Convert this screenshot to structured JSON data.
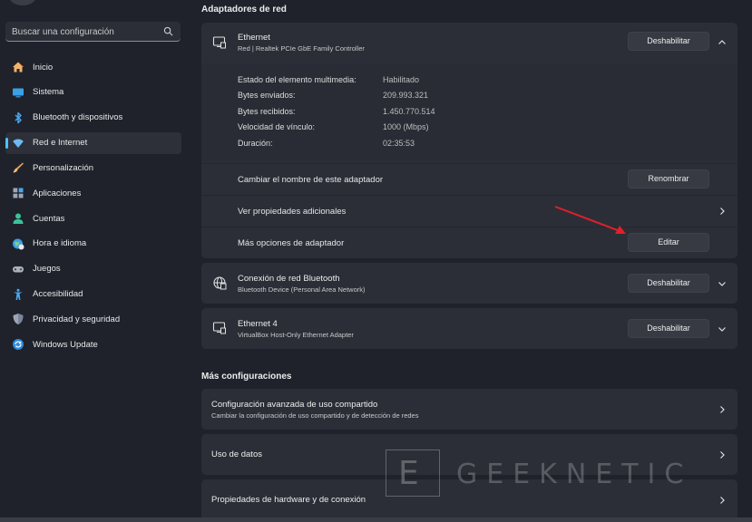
{
  "search": {
    "placeholder": "Buscar una configuración"
  },
  "sidebar": {
    "items": [
      {
        "label": "Inicio",
        "icon": "home-icon",
        "active": false
      },
      {
        "label": "Sistema",
        "icon": "monitor-icon",
        "active": false
      },
      {
        "label": "Bluetooth y dispositivos",
        "icon": "bluetooth-icon",
        "active": false
      },
      {
        "label": "Red e Internet",
        "icon": "wifi-network-icon",
        "active": true
      },
      {
        "label": "Personalización",
        "icon": "brush-icon",
        "active": false
      },
      {
        "label": "Aplicaciones",
        "icon": "apps-icon",
        "active": false
      },
      {
        "label": "Cuentas",
        "icon": "account-icon",
        "active": false
      },
      {
        "label": "Hora e idioma",
        "icon": "globe-clock-icon",
        "active": false
      },
      {
        "label": "Juegos",
        "icon": "gamepad-icon",
        "active": false
      },
      {
        "label": "Accesibilidad",
        "icon": "accessibility-icon",
        "active": false
      },
      {
        "label": "Privacidad y seguridad",
        "icon": "shield-icon",
        "active": false
      },
      {
        "label": "Windows Update",
        "icon": "update-icon",
        "active": false
      }
    ]
  },
  "adapters": {
    "section_title": "Adaptadores de red",
    "ethernet": {
      "title": "Ethernet",
      "subtitle": "Red | Realtek PCIe GbE Family Controller",
      "button": "Deshabilitar",
      "details": [
        {
          "label": "Estado del elemento multimedia:",
          "value": "Habilitado"
        },
        {
          "label": "Bytes enviados:",
          "value": "209.993.321"
        },
        {
          "label": "Bytes recibidos:",
          "value": "1.450.770.514"
        },
        {
          "label": "Velocidad de vínculo:",
          "value": "1000 (Mbps)"
        },
        {
          "label": "Duración:",
          "value": "02:35:53"
        }
      ],
      "rename_label": "Cambiar el nombre de este adaptador",
      "rename_button": "Renombrar",
      "properties_label": "Ver propiedades adicionales",
      "more_options_label": "Más opciones de adaptador",
      "edit_button": "Editar"
    },
    "bluetooth": {
      "title": "Conexión de red Bluetooth",
      "subtitle": "Bluetooth Device (Personal Area Network)",
      "button": "Deshabilitar"
    },
    "ethernet4": {
      "title": "Ethernet 4",
      "subtitle": "VirtualBox Host-Only Ethernet Adapter",
      "button": "Deshabilitar"
    }
  },
  "more": {
    "section_title": "Más configuraciones",
    "sharing": {
      "title": "Configuración avanzada de uso compartido",
      "subtitle": "Cambiar la configuración de uso compartido y de detección de redes"
    },
    "data_usage": {
      "title": "Uso de datos"
    },
    "hardware": {
      "title": "Propiedades de hardware y de conexión"
    }
  },
  "watermark": {
    "text": "GEEKNETIC",
    "letter": "E"
  },
  "colors": {
    "accent": "#4cc2ff",
    "arrow": "#e0202a",
    "card": "#2b2e37",
    "background": "#1f222b"
  }
}
